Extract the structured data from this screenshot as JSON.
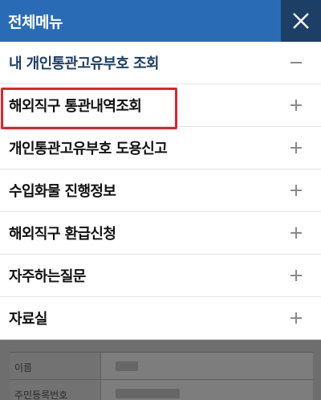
{
  "header": {
    "title": "전체메뉴",
    "close_icon": "close-icon",
    "background_color": "#2a6bb5",
    "close_background_color": "#1d3f66"
  },
  "menu": {
    "items": [
      {
        "label": "내 개인통관고유부호 조회",
        "state": "expanded",
        "sign": "−"
      },
      {
        "label": "해외직구 통관내역조회",
        "state": "highlighted",
        "sign": "+"
      },
      {
        "label": "개인통관고유부호 도용신고",
        "state": "collapsed",
        "sign": "+"
      },
      {
        "label": "수입화물 진행정보",
        "state": "collapsed",
        "sign": "+"
      },
      {
        "label": "해외직구 환급신청",
        "state": "collapsed",
        "sign": "+"
      },
      {
        "label": "자주하는질문",
        "state": "collapsed",
        "sign": "+"
      },
      {
        "label": "자료실",
        "state": "collapsed",
        "sign": "+"
      }
    ],
    "highlight_color": "#e5212b"
  },
  "background_form": {
    "rows": [
      {
        "label": "이름"
      },
      {
        "label": "주민등록번호"
      }
    ]
  }
}
